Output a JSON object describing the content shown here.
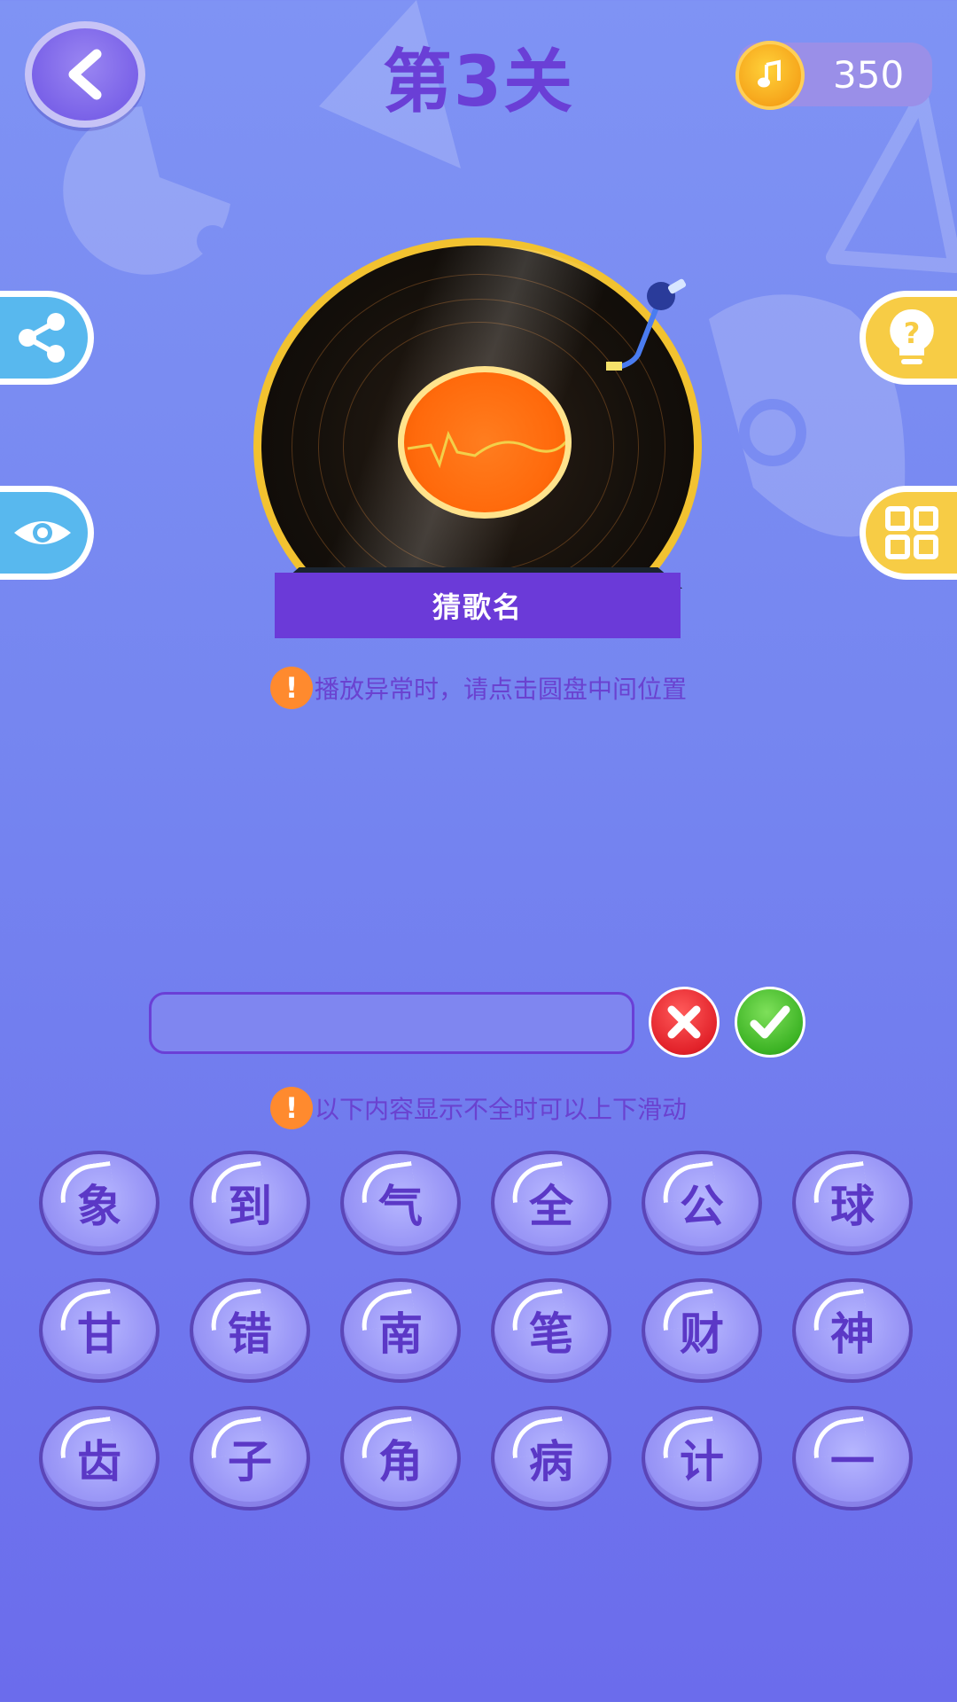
{
  "header": {
    "back_icon": "chevron-left-icon",
    "level_title": "第3关",
    "coins": "350",
    "coin_icon": "music-note-coin-icon"
  },
  "side_buttons": {
    "left": [
      {
        "name": "share",
        "icon": "share-icon"
      },
      {
        "name": "view",
        "icon": "eye-icon"
      }
    ],
    "right": [
      {
        "name": "hint",
        "icon": "lightbulb-question-icon"
      },
      {
        "name": "menu",
        "icon": "grid-icon"
      }
    ]
  },
  "record": {
    "banner": "猜歌名",
    "disc_icon": "vinyl-record-icon",
    "tonearm_icon": "tonearm-icon"
  },
  "tips": {
    "play_issue": "播放异常时，请点击圆盘中间位置",
    "scroll_hint": "以下内容显示不全时可以上下滑动",
    "icon_glyph": "!"
  },
  "answer": {
    "value": "",
    "clear_icon": "x-icon",
    "submit_icon": "check-icon"
  },
  "keys": [
    "象",
    "到",
    "气",
    "全",
    "公",
    "球",
    "甘",
    "错",
    "南",
    "笔",
    "财",
    "神",
    "齿",
    "子",
    "角",
    "病",
    "计",
    "一"
  ],
  "colors": {
    "accent_purple": "#6a3fd6",
    "coin_gold": "#f6a51b",
    "tip_orange": "#ff8a2e",
    "share_blue": "#58b8ee",
    "hint_yellow": "#f7cc45"
  }
}
